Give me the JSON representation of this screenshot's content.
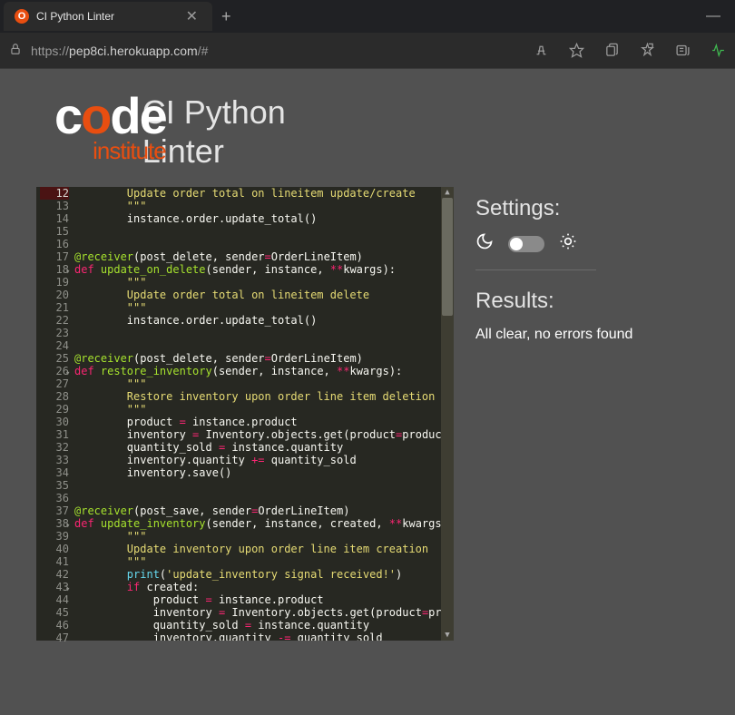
{
  "tab": {
    "icon_char": "O",
    "title": "CI Python Linter",
    "close": "✕"
  },
  "window": {
    "minimize": "—"
  },
  "addr": {
    "lock_icon": "lock",
    "url_prefix": "https://",
    "url_domain": "pep8ci.herokuapp.com",
    "url_suffix": "/#"
  },
  "logo": {
    "c": "c",
    "o": "o",
    "d": "d",
    "e": "e",
    "institute": "institute"
  },
  "title_line1": "CI Python",
  "title_line2": "Linter",
  "settings_label": "Settings:",
  "results_label": "Results:",
  "results_text": "All clear, no errors found",
  "code_start_line": 12,
  "code_lines": [
    [
      {
        "t": "        ",
        "c": ""
      },
      {
        "t": "Update order total on lineitem update/create",
        "c": "str"
      }
    ],
    [
      {
        "t": "        \"\"\"",
        "c": "str"
      }
    ],
    [
      {
        "t": "        instance.order.update_total()",
        "c": ""
      }
    ],
    [
      {
        "t": "",
        "c": ""
      }
    ],
    [
      {
        "t": "",
        "c": ""
      }
    ],
    [
      {
        "t": "@receiver",
        "c": "fn"
      },
      {
        "t": "(post_delete, sender",
        "c": ""
      },
      {
        "t": "=",
        "c": "op"
      },
      {
        "t": "OrderLineItem)",
        "c": ""
      }
    ],
    [
      {
        "t": "def ",
        "c": "kw"
      },
      {
        "t": "update_on_delete",
        "c": "fn"
      },
      {
        "t": "(sender, instance, ",
        "c": ""
      },
      {
        "t": "**",
        "c": "op"
      },
      {
        "t": "kwargs):",
        "c": ""
      }
    ],
    [
      {
        "t": "        \"\"\"",
        "c": "str"
      }
    ],
    [
      {
        "t": "        Update order total on lineitem delete",
        "c": "str"
      }
    ],
    [
      {
        "t": "        \"\"\"",
        "c": "str"
      }
    ],
    [
      {
        "t": "        instance.order.update_total()",
        "c": ""
      }
    ],
    [
      {
        "t": "",
        "c": ""
      }
    ],
    [
      {
        "t": "",
        "c": ""
      }
    ],
    [
      {
        "t": "@receiver",
        "c": "fn"
      },
      {
        "t": "(post_delete, sender",
        "c": ""
      },
      {
        "t": "=",
        "c": "op"
      },
      {
        "t": "OrderLineItem)",
        "c": ""
      }
    ],
    [
      {
        "t": "def ",
        "c": "kw"
      },
      {
        "t": "restore_inventory",
        "c": "fn"
      },
      {
        "t": "(sender, instance, ",
        "c": ""
      },
      {
        "t": "**",
        "c": "op"
      },
      {
        "t": "kwargs):",
        "c": ""
      }
    ],
    [
      {
        "t": "        \"\"\"",
        "c": "str"
      }
    ],
    [
      {
        "t": "        Restore inventory upon order line item deletion",
        "c": "str"
      }
    ],
    [
      {
        "t": "        \"\"\"",
        "c": "str"
      }
    ],
    [
      {
        "t": "        product ",
        "c": ""
      },
      {
        "t": "=",
        "c": "op"
      },
      {
        "t": " instance.product",
        "c": ""
      }
    ],
    [
      {
        "t": "        inventory ",
        "c": ""
      },
      {
        "t": "=",
        "c": "op"
      },
      {
        "t": " Inventory.objects.get(product",
        "c": ""
      },
      {
        "t": "=",
        "c": "op"
      },
      {
        "t": "product)",
        "c": ""
      }
    ],
    [
      {
        "t": "        quantity_sold ",
        "c": ""
      },
      {
        "t": "=",
        "c": "op"
      },
      {
        "t": " instance.quantity",
        "c": ""
      }
    ],
    [
      {
        "t": "        inventory.quantity ",
        "c": ""
      },
      {
        "t": "+=",
        "c": "op"
      },
      {
        "t": " quantity_sold",
        "c": ""
      }
    ],
    [
      {
        "t": "        inventory.save()",
        "c": ""
      }
    ],
    [
      {
        "t": "",
        "c": ""
      }
    ],
    [
      {
        "t": "",
        "c": ""
      }
    ],
    [
      {
        "t": "@receiver",
        "c": "fn"
      },
      {
        "t": "(post_save, sender",
        "c": ""
      },
      {
        "t": "=",
        "c": "op"
      },
      {
        "t": "OrderLineItem)",
        "c": ""
      }
    ],
    [
      {
        "t": "def ",
        "c": "kw"
      },
      {
        "t": "update_inventory",
        "c": "fn"
      },
      {
        "t": "(sender, instance, created, ",
        "c": ""
      },
      {
        "t": "**",
        "c": "op"
      },
      {
        "t": "kwargs):",
        "c": ""
      }
    ],
    [
      {
        "t": "        \"\"\"",
        "c": "str"
      }
    ],
    [
      {
        "t": "        Update inventory upon order line item creation",
        "c": "str"
      }
    ],
    [
      {
        "t": "        \"\"\"",
        "c": "str"
      }
    ],
    [
      {
        "t": "        ",
        "c": ""
      },
      {
        "t": "print",
        "c": "builtin"
      },
      {
        "t": "(",
        "c": ""
      },
      {
        "t": "'update_inventory signal received!'",
        "c": "str"
      },
      {
        "t": ")",
        "c": ""
      }
    ],
    [
      {
        "t": "        ",
        "c": ""
      },
      {
        "t": "if",
        "c": "kw"
      },
      {
        "t": " created:",
        "c": ""
      }
    ],
    [
      {
        "t": "            product ",
        "c": ""
      },
      {
        "t": "=",
        "c": "op"
      },
      {
        "t": " instance.product",
        "c": ""
      }
    ],
    [
      {
        "t": "            inventory ",
        "c": ""
      },
      {
        "t": "=",
        "c": "op"
      },
      {
        "t": " Inventory.objects.get(product",
        "c": ""
      },
      {
        "t": "=",
        "c": "op"
      },
      {
        "t": "product)",
        "c": ""
      }
    ],
    [
      {
        "t": "            quantity_sold ",
        "c": ""
      },
      {
        "t": "=",
        "c": "op"
      },
      {
        "t": " instance.quantity",
        "c": ""
      }
    ],
    [
      {
        "t": "            inventory.quantity ",
        "c": ""
      },
      {
        "t": "-=",
        "c": "op"
      },
      {
        "t": " quantity_sold",
        "c": ""
      }
    ]
  ],
  "fold_lines": [
    18,
    26,
    38,
    43
  ]
}
